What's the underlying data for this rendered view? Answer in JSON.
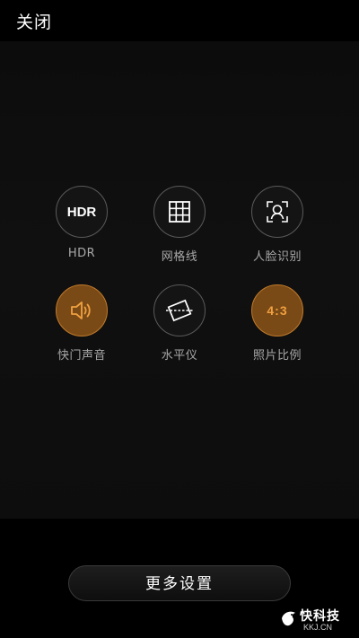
{
  "header": {
    "close_label": "关闭"
  },
  "settings": {
    "items": [
      {
        "label": "HDR",
        "icon": "hdr-icon",
        "icon_text": "HDR",
        "active": false
      },
      {
        "label": "网格线",
        "icon": "grid-lines-icon",
        "active": false
      },
      {
        "label": "人脸识别",
        "icon": "face-detect-icon",
        "active": false
      },
      {
        "label": "快门声音",
        "icon": "speaker-icon",
        "active": true
      },
      {
        "label": "水平仪",
        "icon": "level-icon",
        "active": false
      },
      {
        "label": "照片比例",
        "icon": "aspect-ratio-icon",
        "icon_text": "4:3",
        "active": true
      }
    ]
  },
  "footer": {
    "more_settings_label": "更多设置"
  },
  "watermark": {
    "main": "快科技",
    "sub": "KKJ.CN"
  },
  "colors": {
    "background": "#000000",
    "panel": "#0e0e0e",
    "active_fill": "#7a4a16",
    "active_border": "#c07a2a",
    "accent_text": "#f0a040"
  }
}
